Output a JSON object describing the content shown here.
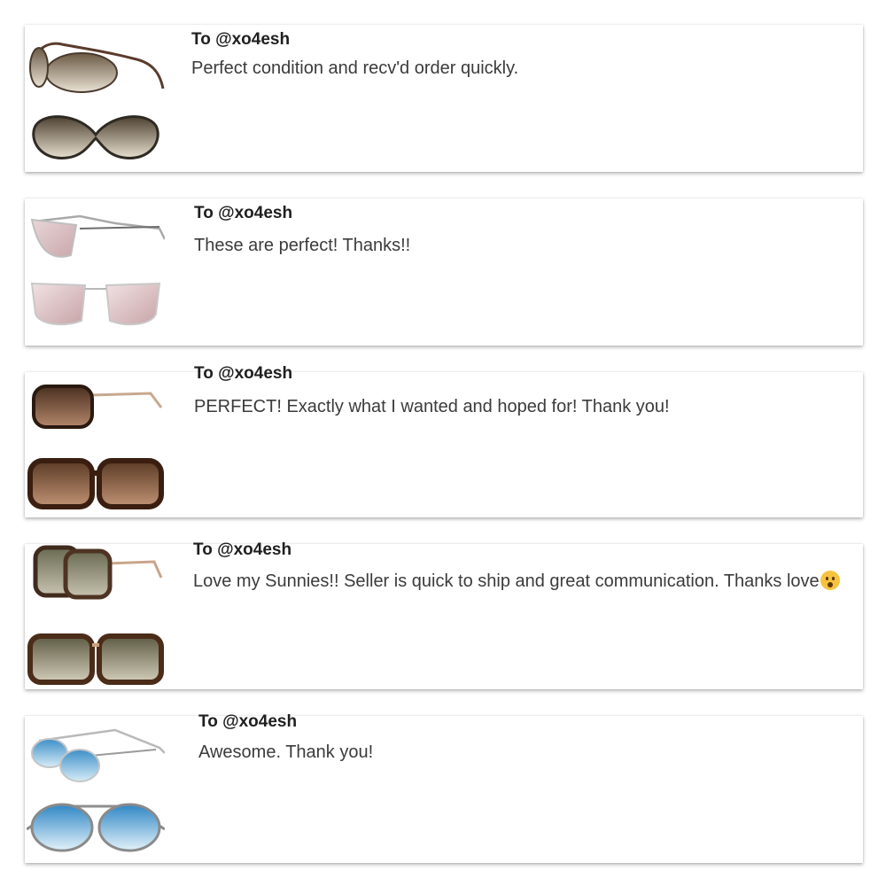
{
  "reviews": [
    {
      "to": "To @xo4esh",
      "message": "Perfect condition and recv'd order quickly.",
      "emoji": ""
    },
    {
      "to": "To @xo4esh",
      "message": "These are perfect! Thanks!!",
      "emoji": ""
    },
    {
      "to": "To @xo4esh",
      "message": "PERFECT! Exactly what I wanted and hoped for! Thank you!",
      "emoji": ""
    },
    {
      "to": "To @xo4esh",
      "message": "Love my Sunnies!! Seller is quick to ship and great communication. Thanks love",
      "emoji": "hushed-face-emoji"
    },
    {
      "to": "To @xo4esh",
      "message": "Awesome. Thank you!",
      "emoji": ""
    }
  ],
  "colors": {
    "card_background": "#ffffff",
    "recipient_text": "#1f1f1f",
    "message_text": "#3b3b3b"
  }
}
